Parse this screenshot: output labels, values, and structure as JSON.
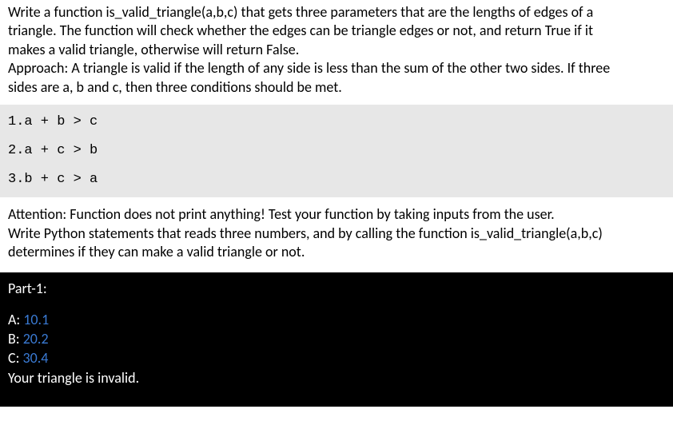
{
  "problem": {
    "line1": "Write a function is_valid_triangle(a,b,c) that gets three parameters that are the lengths of edges of a",
    "line2": "triangle. The function will check whether the edges can be triangle edges or not, and return True if it",
    "line3": "makes a valid triangle, otherwise will return False.",
    "line4": "Approach: A triangle is valid if the length of any side is less than the sum of the other two sides. If three",
    "line5": "sides are a, b and c, then three conditions should be met."
  },
  "conditions": {
    "c1": "1.a + b > c",
    "c2": "2.a + c > b",
    "c3": "3.b + c > a"
  },
  "attention": {
    "line1": "Attention: Function does not print anything! Test your function by taking inputs from the user.",
    "line2": "Write Python statements that reads three numbers, and by calling the function is_valid_triangle(a,b,c)",
    "line3": "determines if they can make a valid triangle or not."
  },
  "terminal": {
    "part_label": "Part-1:",
    "promptA": "A: ",
    "valA": "10.1",
    "promptB": "B: ",
    "valB": "20.2",
    "promptC": "C: ",
    "valC": "30.4",
    "result": "Your triangle is invalid."
  }
}
